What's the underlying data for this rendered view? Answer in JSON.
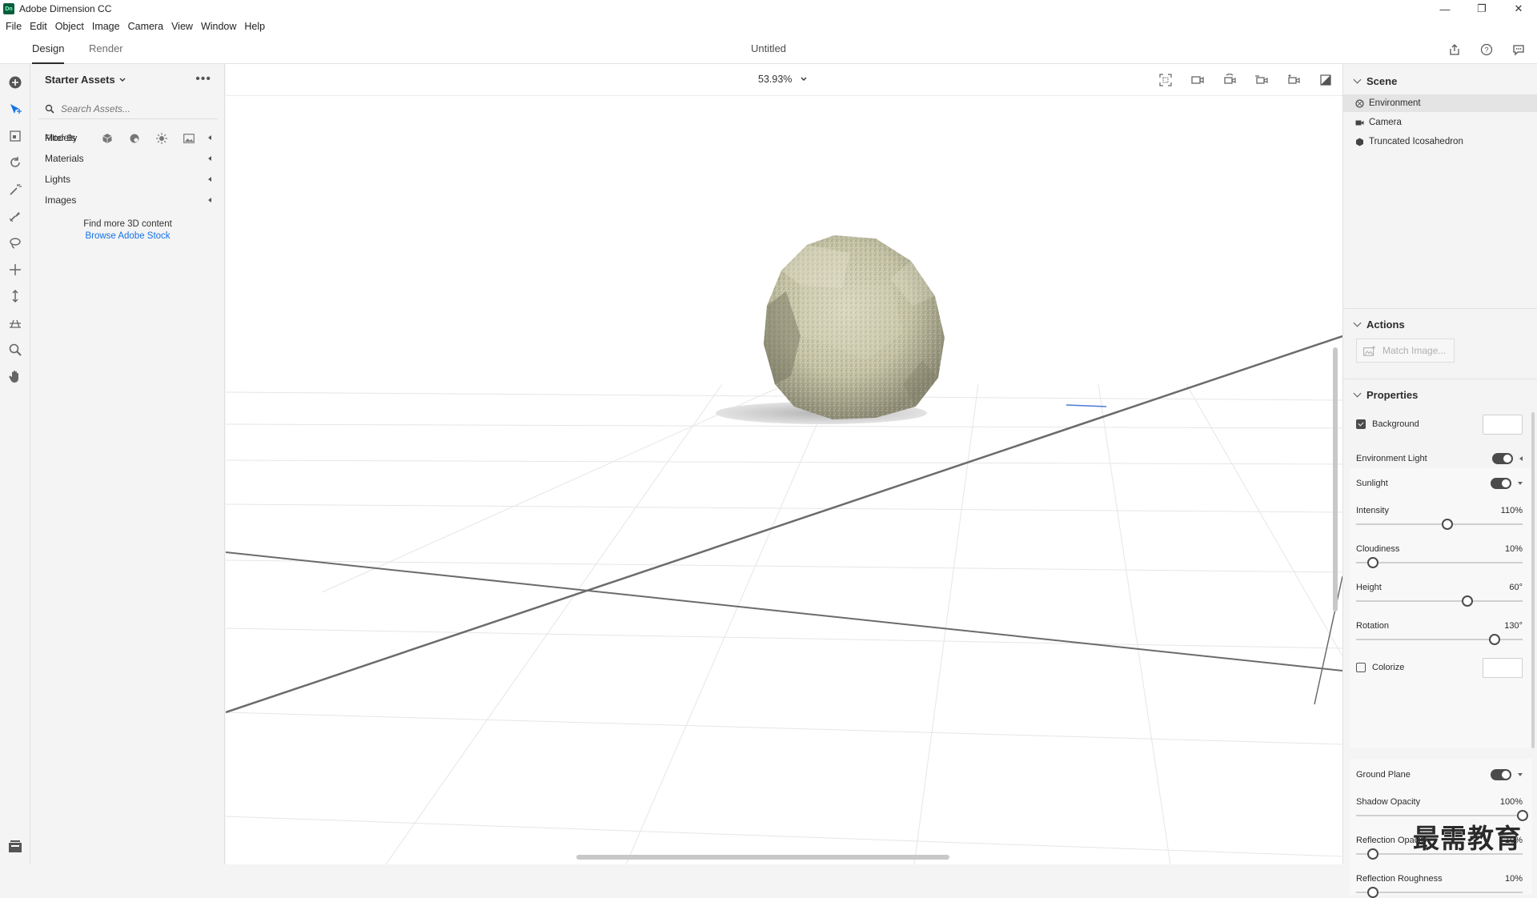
{
  "window": {
    "title": "Adobe Dimension CC",
    "logo_text": "Dn"
  },
  "menu": [
    "File",
    "Edit",
    "Object",
    "Image",
    "Camera",
    "View",
    "Window",
    "Help"
  ],
  "tabs": {
    "design": "Design",
    "render": "Render"
  },
  "document": {
    "title": "Untitled"
  },
  "assets": {
    "header": "Starter Assets",
    "search_placeholder": "Search Assets...",
    "filter_label": "Filter By",
    "categories": [
      "Models",
      "Materials",
      "Lights",
      "Images"
    ],
    "find_more": "Find more 3D content",
    "browse_link": "Browse Adobe Stock"
  },
  "viewport": {
    "zoom": "53.93%"
  },
  "scene": {
    "header": "Scene",
    "items": [
      "Environment",
      "Camera",
      "Truncated Icosahedron"
    ],
    "selected": "Environment"
  },
  "actions": {
    "header": "Actions",
    "match_image": "Match Image..."
  },
  "properties": {
    "header": "Properties",
    "background": {
      "label": "Background",
      "checked": true
    },
    "environment_light": {
      "label": "Environment Light",
      "on": true
    },
    "sunlight": {
      "label": "Sunlight",
      "on": true,
      "intensity": {
        "label": "Intensity",
        "value": "110%",
        "level": 0.55
      },
      "cloudiness": {
        "label": "Cloudiness",
        "value": "10%",
        "level": 0.1
      },
      "height": {
        "label": "Height",
        "value": "60°",
        "level": 0.67
      },
      "rotation": {
        "label": "Rotation",
        "value": "130°",
        "level": 0.83
      },
      "colorize": {
        "label": "Colorize",
        "checked": false
      }
    },
    "ground_plane": {
      "label": "Ground Plane",
      "on": true,
      "shadow_opacity": {
        "label": "Shadow Opacity",
        "value": "100%",
        "level": 1.0
      },
      "reflection_opacity": {
        "label": "Reflection Opacity",
        "value": "10%",
        "level": 0.1
      },
      "reflection_roughness": {
        "label": "Reflection Roughness",
        "value": "10%",
        "level": 0.1
      }
    }
  },
  "watermark": "最需教育",
  "colors": {
    "accent_link": "#1473e6",
    "toggle_on": "#4b4b4b",
    "model_fill": "#cfcdb0"
  }
}
